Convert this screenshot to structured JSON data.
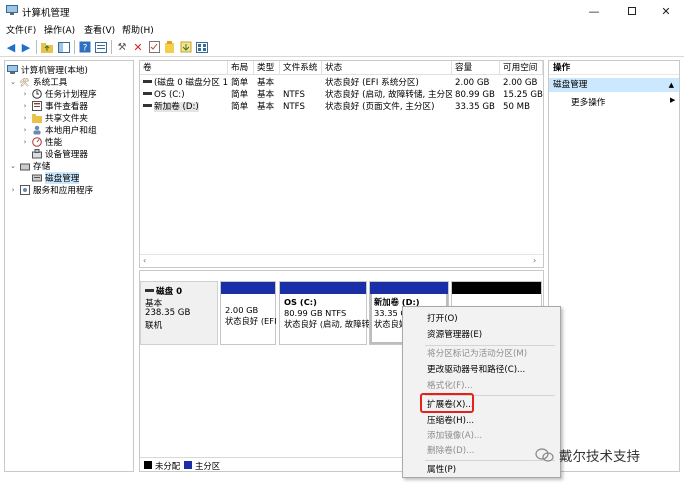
{
  "window": {
    "title": "计算机管理",
    "controls": [
      "minimize-icon",
      "maximize-icon",
      "close-icon"
    ]
  },
  "menu": [
    "文件(F)",
    "操作(A)",
    "查看(V)",
    "帮助(H)"
  ],
  "tree": {
    "root": "计算机管理(本地)",
    "system_tools": "系统工具",
    "task_scheduler": "任务计划程序",
    "event_viewer": "事件查看器",
    "shared_folders": "共享文件夹",
    "local_users": "本地用户和组",
    "performance": "性能",
    "device_manager": "设备管理器",
    "storage": "存储",
    "disk_management": "磁盘管理",
    "services": "服务和应用程序"
  },
  "volumes": {
    "headers": [
      "卷",
      "布局",
      "类型",
      "文件系统",
      "状态",
      "容量",
      "可用空间"
    ],
    "rows": [
      [
        "(磁盘 0 磁盘分区 1)",
        "简单",
        "基本",
        "",
        "状态良好 (EFI 系统分区)",
        "2.00 GB",
        "2.00 GB"
      ],
      [
        "OS (C:)",
        "简单",
        "基本",
        "NTFS",
        "状态良好 (启动, 故障转储, 主分区)",
        "80.99 GB",
        "15.25 GB"
      ],
      [
        "新加卷 (D:)",
        "简单",
        "基本",
        "NTFS",
        "状态良好 (页面文件, 主分区)",
        "33.35 GB",
        "50 MB"
      ]
    ]
  },
  "disk": {
    "name": "磁盘 0",
    "type": "基本",
    "size": "238.35 GB",
    "status": "联机",
    "partitions": [
      {
        "name": "",
        "size": "2.00 GB",
        "status": "状态良好 (EFI"
      },
      {
        "name": "OS (C:)",
        "size": "80.99 GB NTFS",
        "status": "状态良好 (启动, 故障转"
      },
      {
        "name": "新加卷 (D:)",
        "size": "33.35 G",
        "status": "状态良好"
      },
      {
        "name": "",
        "size": "",
        "status": ""
      }
    ]
  },
  "legend": {
    "unallocated": "未分配",
    "primary": "主分区",
    "unallocated_color": "#000000",
    "primary_color": "#1a2ea8"
  },
  "actions": {
    "header": "操作",
    "section": "磁盘管理",
    "more": "更多操作"
  },
  "context_menu": [
    {
      "label": "打开(O)",
      "enabled": true
    },
    {
      "label": "资源管理器(E)",
      "enabled": true
    },
    {
      "label": "将分区标记为活动分区(M)",
      "enabled": false
    },
    {
      "label": "更改驱动器号和路径(C)...",
      "enabled": true
    },
    {
      "label": "格式化(F)...",
      "enabled": false
    },
    {
      "label": "扩展卷(X)...",
      "enabled": true
    },
    {
      "label": "压缩卷(H)...",
      "enabled": true
    },
    {
      "label": "添加镜像(A)...",
      "enabled": false
    },
    {
      "label": "删除卷(D)...",
      "enabled": false
    },
    {
      "label": "属性(P)",
      "enabled": true
    }
  ],
  "watermark": "戴尔技术支持",
  "highlight_color": "#e0241b"
}
